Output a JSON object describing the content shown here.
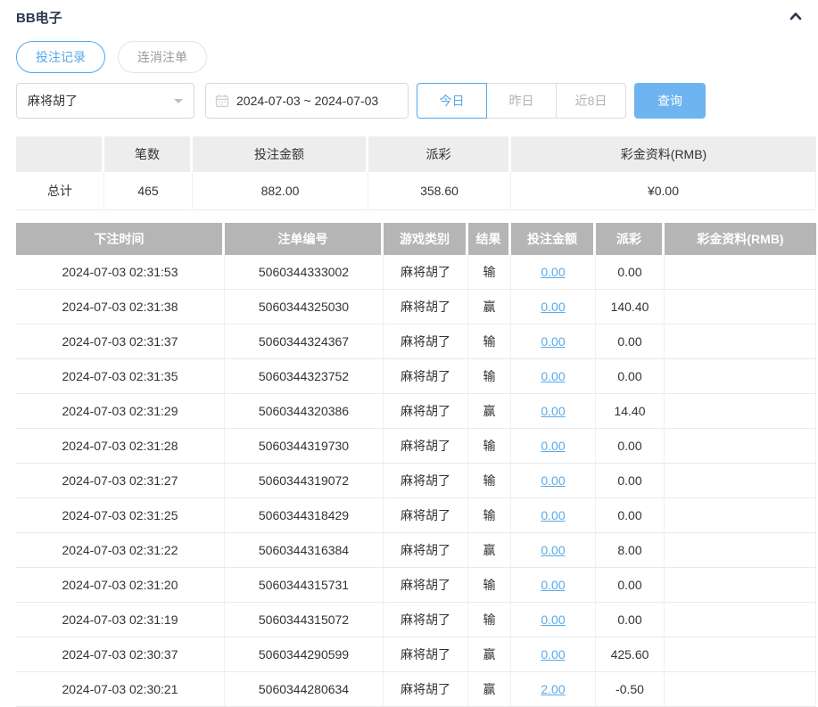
{
  "header": {
    "title": "BB电子"
  },
  "tabs": [
    {
      "label": "投注记录",
      "active": true
    },
    {
      "label": "连消注单",
      "active": false
    }
  ],
  "filters": {
    "game_select": {
      "value": "麻将胡了"
    },
    "date_range": {
      "value": "2024-07-03 ~ 2024-07-03"
    },
    "quick_buttons": [
      {
        "label": "今日",
        "active": true
      },
      {
        "label": "昨日",
        "active": false
      },
      {
        "label": "近8日",
        "active": false
      }
    ],
    "search_label": "查询"
  },
  "summary": {
    "headers": [
      "",
      "笔数",
      "投注金额",
      "派彩",
      "彩金资料(RMB)"
    ],
    "total": {
      "label": "总计",
      "count": "465",
      "bet_amount": "882.00",
      "payout": "358.60",
      "jackpot": "¥0.00"
    }
  },
  "table": {
    "headers": [
      "下注时间",
      "注单编号",
      "游戏类别",
      "结果",
      "投注金额",
      "派彩",
      "彩金资料(RMB)"
    ],
    "rows": [
      {
        "time": "2024-07-03 02:31:53",
        "order_no": "5060344333002",
        "game": "麻将胡了",
        "result": "输",
        "bet": "0.00",
        "payout": "0.00",
        "jackpot": ""
      },
      {
        "time": "2024-07-03 02:31:38",
        "order_no": "5060344325030",
        "game": "麻将胡了",
        "result": "赢",
        "bet": "0.00",
        "payout": "140.40",
        "jackpot": ""
      },
      {
        "time": "2024-07-03 02:31:37",
        "order_no": "5060344324367",
        "game": "麻将胡了",
        "result": "输",
        "bet": "0.00",
        "payout": "0.00",
        "jackpot": ""
      },
      {
        "time": "2024-07-03 02:31:35",
        "order_no": "5060344323752",
        "game": "麻将胡了",
        "result": "输",
        "bet": "0.00",
        "payout": "0.00",
        "jackpot": ""
      },
      {
        "time": "2024-07-03 02:31:29",
        "order_no": "5060344320386",
        "game": "麻将胡了",
        "result": "赢",
        "bet": "0.00",
        "payout": "14.40",
        "jackpot": ""
      },
      {
        "time": "2024-07-03 02:31:28",
        "order_no": "5060344319730",
        "game": "麻将胡了",
        "result": "输",
        "bet": "0.00",
        "payout": "0.00",
        "jackpot": ""
      },
      {
        "time": "2024-07-03 02:31:27",
        "order_no": "5060344319072",
        "game": "麻将胡了",
        "result": "输",
        "bet": "0.00",
        "payout": "0.00",
        "jackpot": ""
      },
      {
        "time": "2024-07-03 02:31:25",
        "order_no": "5060344318429",
        "game": "麻将胡了",
        "result": "输",
        "bet": "0.00",
        "payout": "0.00",
        "jackpot": ""
      },
      {
        "time": "2024-07-03 02:31:22",
        "order_no": "5060344316384",
        "game": "麻将胡了",
        "result": "赢",
        "bet": "0.00",
        "payout": "8.00",
        "jackpot": ""
      },
      {
        "time": "2024-07-03 02:31:20",
        "order_no": "5060344315731",
        "game": "麻将胡了",
        "result": "输",
        "bet": "0.00",
        "payout": "0.00",
        "jackpot": ""
      },
      {
        "time": "2024-07-03 02:31:19",
        "order_no": "5060344315072",
        "game": "麻将胡了",
        "result": "输",
        "bet": "0.00",
        "payout": "0.00",
        "jackpot": ""
      },
      {
        "time": "2024-07-03 02:30:37",
        "order_no": "5060344290599",
        "game": "麻将胡了",
        "result": "赢",
        "bet": "0.00",
        "payout": "425.60",
        "jackpot": ""
      },
      {
        "time": "2024-07-03 02:30:21",
        "order_no": "5060344280634",
        "game": "麻将胡了",
        "result": "赢",
        "bet": "2.00",
        "payout": "-0.50",
        "jackpot": ""
      }
    ]
  },
  "colors": {
    "accent_blue": "#53a8ec",
    "search_button_bg": "#6db4f0",
    "link_blue": "#5aaae8",
    "negative_red": "#f0595f",
    "table_header_bg": "#b5b5b5",
    "summary_header_bg": "#ededed",
    "title_navy": "#2b3950"
  }
}
